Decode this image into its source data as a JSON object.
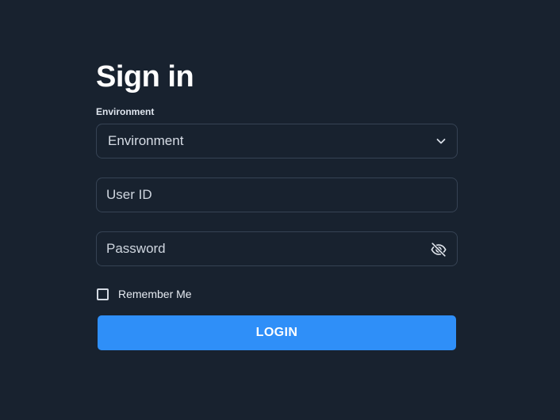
{
  "signin": {
    "title": "Sign in",
    "environment_label": "Environment",
    "environment_selected": "Environment",
    "userid_placeholder": "User ID",
    "password_placeholder": "Password",
    "remember_label": "Remember Me",
    "login_label": "LOGIN"
  },
  "icons": {
    "environment_dropdown": "chevron-down-icon",
    "password_toggle": "eye-off-icon"
  },
  "colors": {
    "background": "#18222f",
    "field_border": "#364354",
    "accent": "#2f8ff8",
    "text": "#ffffff"
  }
}
